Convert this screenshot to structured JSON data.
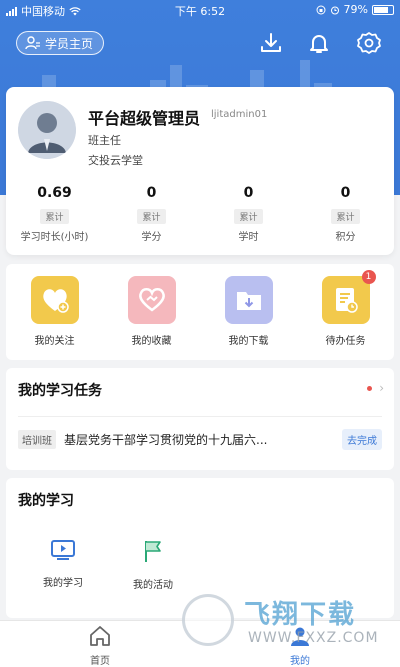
{
  "status_bar": {
    "carrier": "中国移动",
    "time": "下午 6:52",
    "battery": "79%"
  },
  "header": {
    "home_pill_label": "学员主页"
  },
  "profile": {
    "name": "平台超级管理员",
    "account": "ljitadmin01",
    "role": "班主任",
    "org": "交投云学堂"
  },
  "stats": [
    {
      "value": "0.69",
      "tag": "累计",
      "label": "学习时长(小时)"
    },
    {
      "value": "0",
      "tag": "累计",
      "label": "学分"
    },
    {
      "value": "0",
      "tag": "累计",
      "label": "学时"
    },
    {
      "value": "0",
      "tag": "累计",
      "label": "积分"
    }
  ],
  "quick_actions": [
    {
      "label": "我的关注",
      "color": "#f2c94c"
    },
    {
      "label": "我的收藏",
      "color": "#f5b8bd"
    },
    {
      "label": "我的下载",
      "color": "#b9bff0"
    },
    {
      "label": "待办任务",
      "color": "#f2c94c",
      "badge": "1"
    }
  ],
  "tasks": {
    "title": "我的学习任务",
    "item": {
      "tag": "培训班",
      "text": "基层党务干部学习贯彻党的十九届六...",
      "button": "去完成"
    }
  },
  "study": {
    "title": "我的学习",
    "items": [
      {
        "label": "我的学习"
      },
      {
        "label": "我的活动"
      }
    ]
  },
  "tabbar": {
    "items": [
      {
        "label": "首页",
        "active": false
      },
      {
        "label": "我的",
        "active": true
      }
    ]
  },
  "watermark": {
    "title": "飞翔下载",
    "url": "WWW.FXXZ.COM"
  },
  "colors": {
    "primary": "#3b78d6",
    "badge": "#e9554f"
  }
}
